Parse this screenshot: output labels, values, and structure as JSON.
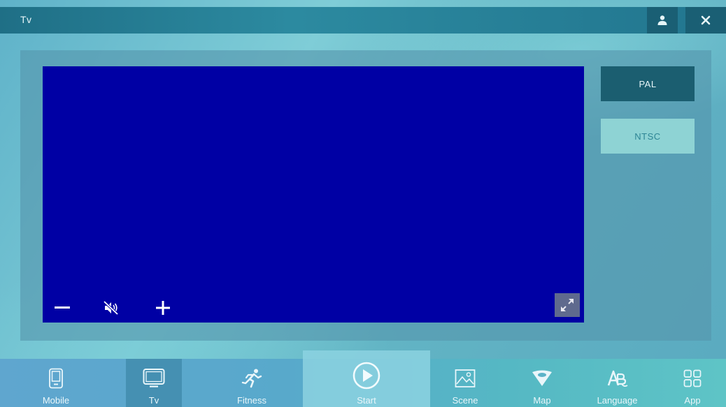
{
  "window": {
    "title": "Tv"
  },
  "standards": {
    "pal_label": "PAL",
    "ntsc_label": "NTSC",
    "selected": "PAL"
  },
  "player": {
    "screen_color": "#0000a4",
    "muted": true
  },
  "nav": {
    "items": [
      {
        "label": "Mobile",
        "icon": "mobile-icon"
      },
      {
        "label": "Tv",
        "icon": "tv-icon",
        "active": true
      },
      {
        "label": "Fitness",
        "icon": "running-icon"
      },
      {
        "label": "Start",
        "icon": "play-circle-icon"
      },
      {
        "label": "Scene",
        "icon": "picture-icon"
      },
      {
        "label": "Map",
        "icon": "map-pin-icon"
      },
      {
        "label": "Language",
        "icon": "language-icon"
      },
      {
        "label": "App",
        "icon": "app-grid-icon"
      }
    ]
  },
  "colors": {
    "titlebar": "#22768f",
    "pal_button": "#1b5e70",
    "ntsc_button": "#8ed3d4"
  }
}
